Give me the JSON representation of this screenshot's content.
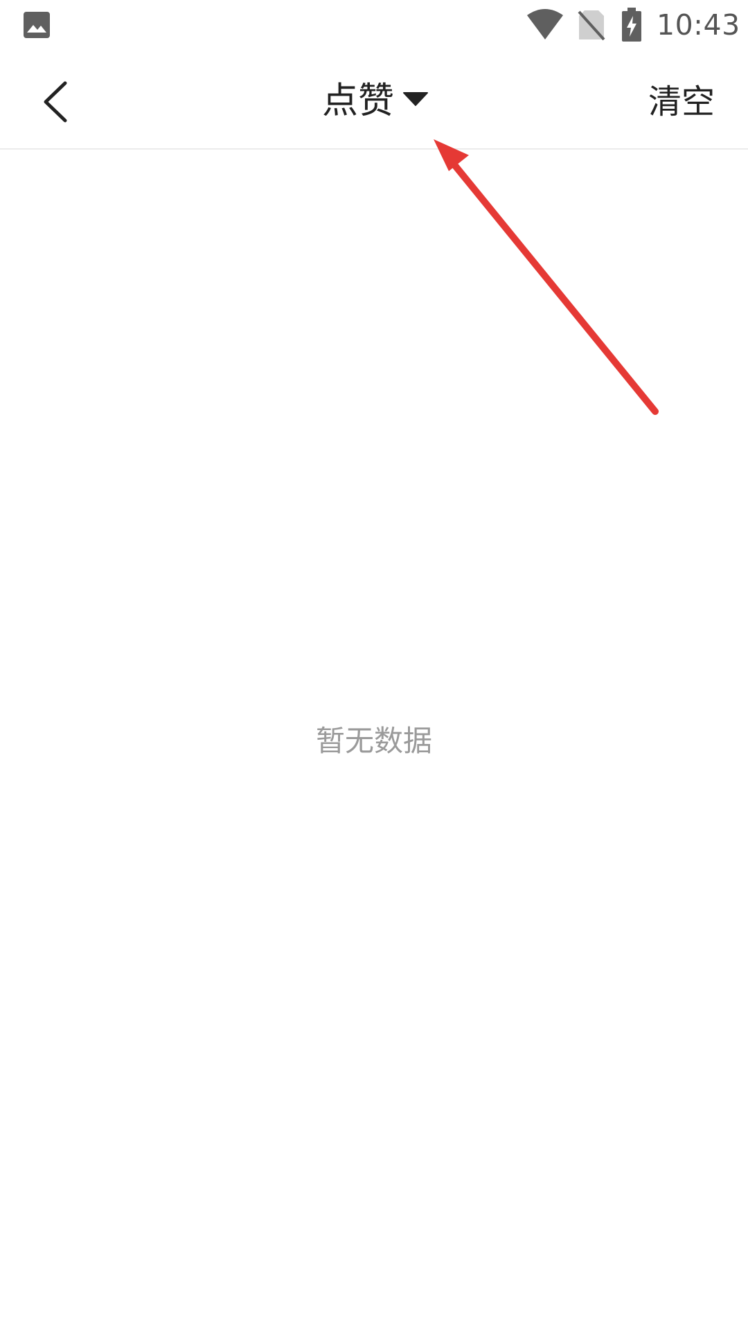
{
  "status_bar": {
    "time": "10:43",
    "icons": [
      "gallery-icon",
      "wifi-icon",
      "no-sim-icon",
      "battery-charging-icon"
    ]
  },
  "nav": {
    "title": "点赞",
    "clear_label": "清空"
  },
  "main": {
    "empty_text": "暂无数据"
  },
  "colors": {
    "annotation_arrow": "#e53935",
    "title_text": "#222222",
    "empty_text": "#9a9a9a",
    "status_icons": "#555555"
  }
}
